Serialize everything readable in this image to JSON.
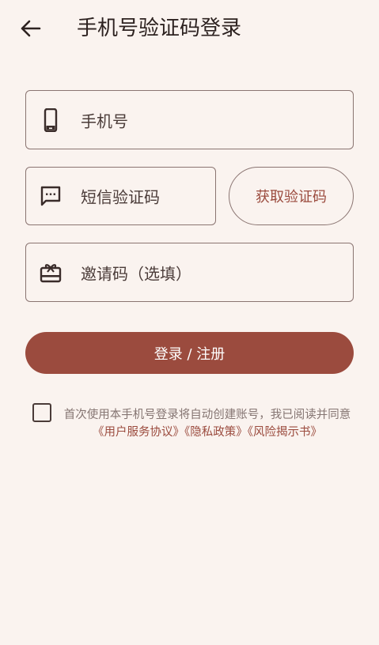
{
  "header": {
    "title": "手机号验证码登录",
    "back_icon": "arrow-left-icon"
  },
  "form": {
    "phone": {
      "placeholder": "手机号",
      "icon": "smartphone-icon"
    },
    "sms_code": {
      "placeholder": "短信验证码",
      "icon": "sms-icon"
    },
    "get_code_label": "获取验证码",
    "invite": {
      "placeholder": "邀请码（选填）",
      "icon": "gift-card-icon"
    },
    "submit_label": "登录 / 注册"
  },
  "agreement": {
    "prefix": "首次使用本手机号登录将自动创建账号，我已阅读并同意",
    "links": [
      "《用户服务协议》",
      "《隐私政策》",
      "《风险揭示书》"
    ],
    "checked": false
  },
  "colors": {
    "background": "#faf3ef",
    "accent": "#9b4b3e",
    "border": "#8a7471"
  }
}
